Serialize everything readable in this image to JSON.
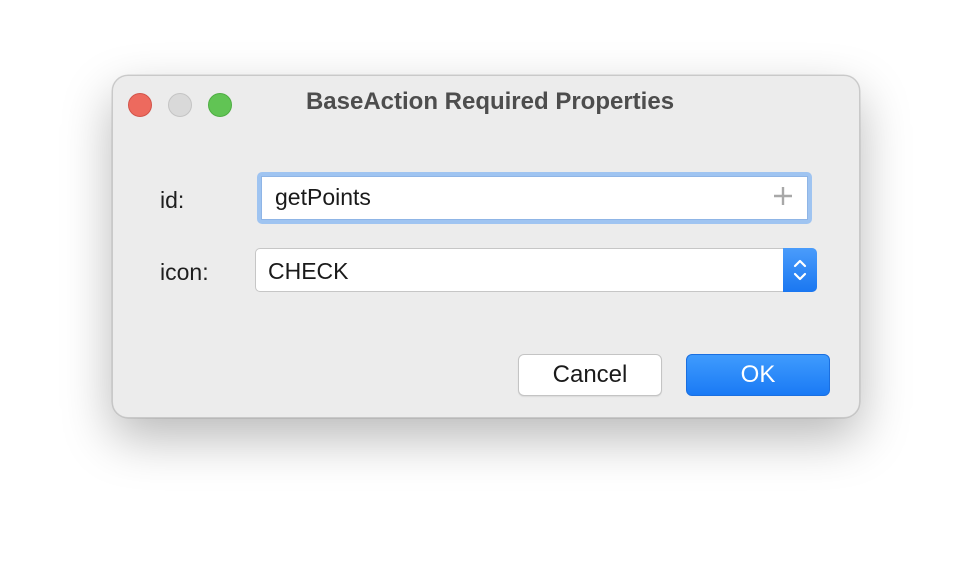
{
  "window": {
    "title": "BaseAction Required Properties",
    "traffic_lights": {
      "close_color": "#ed6a5e",
      "minimize_color": "#d9d9d9",
      "maximize_color": "#61c454"
    }
  },
  "form": {
    "id_label": "id:",
    "id_value": "getPoints",
    "id_field_icon": "plus-icon",
    "icon_label": "icon:",
    "icon_value": "CHECK",
    "icon_select_icon": "chevron-up-down-icon"
  },
  "buttons": {
    "cancel_label": "Cancel",
    "ok_label": "OK",
    "accent_color": "#1a7af5"
  }
}
